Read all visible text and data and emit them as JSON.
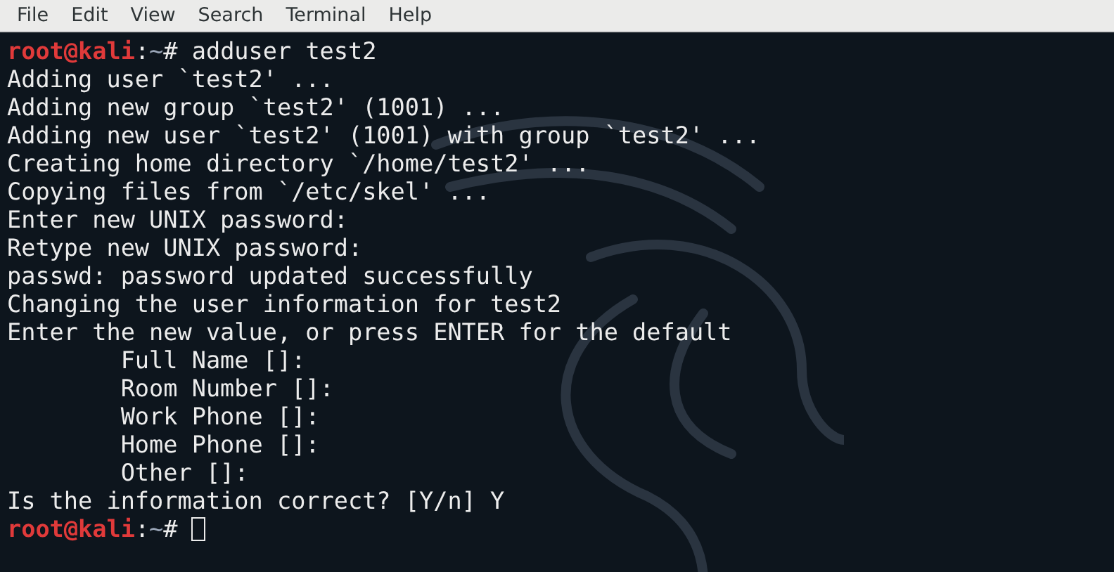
{
  "menu": [
    "File",
    "Edit",
    "View",
    "Search",
    "Terminal",
    "Help"
  ],
  "lines": [
    {
      "kind": "prompt",
      "user": "root@kali",
      "separator": ":",
      "path": "~",
      "symbol": "#",
      "command": "adduser test2",
      "cursor": false
    },
    {
      "kind": "output",
      "text": "Adding user `test2' ..."
    },
    {
      "kind": "output",
      "text": "Adding new group `test2' (1001) ..."
    },
    {
      "kind": "output",
      "text": "Adding new user `test2' (1001) with group `test2' ..."
    },
    {
      "kind": "output",
      "text": "Creating home directory `/home/test2' ..."
    },
    {
      "kind": "output",
      "text": "Copying files from `/etc/skel' ..."
    },
    {
      "kind": "output",
      "text": "Enter new UNIX password:"
    },
    {
      "kind": "output",
      "text": "Retype new UNIX password:"
    },
    {
      "kind": "output",
      "text": "passwd: password updated successfully"
    },
    {
      "kind": "output",
      "text": "Changing the user information for test2"
    },
    {
      "kind": "output",
      "text": "Enter the new value, or press ENTER for the default"
    },
    {
      "kind": "output",
      "text": "\tFull Name []:"
    },
    {
      "kind": "output",
      "text": "\tRoom Number []:"
    },
    {
      "kind": "output",
      "text": "\tWork Phone []:"
    },
    {
      "kind": "output",
      "text": "\tHome Phone []:"
    },
    {
      "kind": "output",
      "text": "\tOther []:"
    },
    {
      "kind": "output",
      "text": "Is the information correct? [Y/n] Y"
    },
    {
      "kind": "prompt",
      "user": "root@kali",
      "separator": ":",
      "path": "~",
      "symbol": "#",
      "cursor": true
    }
  ]
}
